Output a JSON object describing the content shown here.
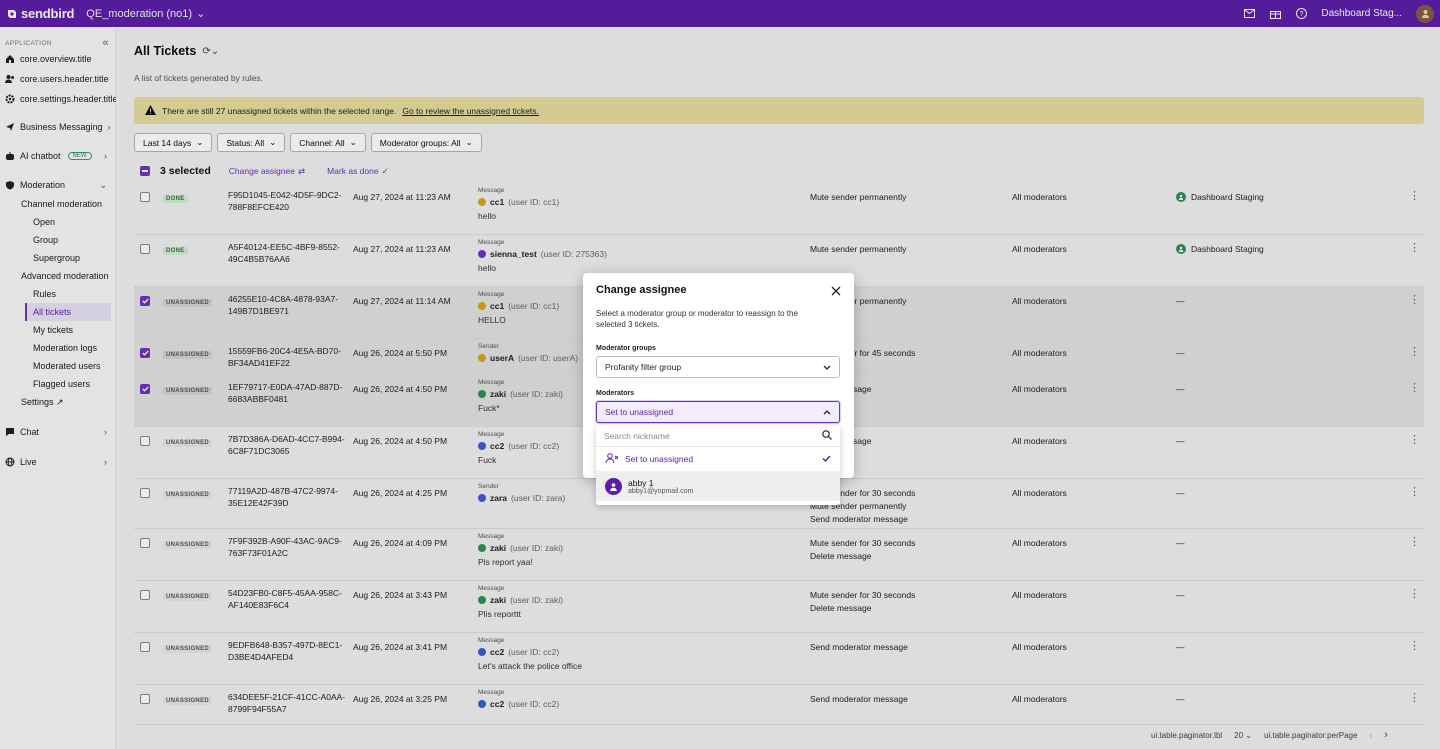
{
  "topbar": {
    "brand": "sendbird",
    "app_name": "QE_moderation (no1)",
    "org_name": "Dashboard Stag..."
  },
  "sidebar": {
    "section_label": "APPLICATION",
    "items": [
      {
        "label": "core.overview.title",
        "icon": "home-icon"
      },
      {
        "label": "core.users.header.title",
        "icon": "users-icon"
      },
      {
        "label": "core.settings.header.title",
        "icon": "gear-icon"
      },
      {
        "label": "Business Messaging",
        "icon": "send-icon"
      },
      {
        "label": "AI chatbot",
        "icon": "bot-icon",
        "badge": "NEW"
      },
      {
        "label": "Moderation",
        "icon": "shield-icon"
      },
      {
        "label": "Chat",
        "icon": "chat-icon"
      },
      {
        "label": "Live",
        "icon": "globe-icon"
      }
    ],
    "moderation": {
      "channel_moderation": "Channel moderation",
      "channel_items": [
        "Open",
        "Group",
        "Supergroup"
      ],
      "advanced_moderation": "Advanced moderation",
      "advanced_items": [
        "Rules",
        "All tickets",
        "My tickets",
        "Moderation logs",
        "Moderated users",
        "Flagged users"
      ],
      "settings": "Settings ↗"
    }
  },
  "page": {
    "title": "All Tickets",
    "description": "A list of tickets generated by rules.",
    "banner_text": "There are still 27 unassigned tickets within the selected range.",
    "banner_link": "Go to review the unassigned tickets."
  },
  "filters": [
    "Last 14 days",
    "Status: All",
    "Channel: All",
    "Moderator groups: All"
  ],
  "selection": {
    "count_label": "3 selected",
    "change_assignee": "Change assignee",
    "mark_as_done": "Mark as done"
  },
  "tickets": [
    {
      "checked": false,
      "status": "DONE",
      "id1": "F95D1045-E042-4D5F-9DC2-",
      "id2": "788F8EFCE420",
      "date": "Aug 27, 2024 at 11:23 AM",
      "type": "Message",
      "user": "cc1",
      "uid": "(user ID: cc1)",
      "text": "hello",
      "action1": "Mute sender permanently",
      "action2": "",
      "action3": "",
      "group": "All moderators",
      "assignee": "Dashboard Staging",
      "avatar_color": "#d9a520"
    },
    {
      "checked": false,
      "status": "DONE",
      "id1": "A5F40124-EE5C-4BF9-8552-",
      "id2": "49C4B5B76AA6",
      "date": "Aug 27, 2024 at 11:23 AM",
      "type": "Message",
      "user": "sienna_test",
      "uid": "(user ID: 275363)",
      "text": "hello",
      "action1": "Mute sender permanently",
      "action2": "",
      "action3": "",
      "group": "All moderators",
      "assignee": "Dashboard Staging",
      "avatar_color": "#6a34c2"
    },
    {
      "checked": true,
      "status": "UNASSIGNED",
      "id1": "46255E10-4C8A-4878-93A7-",
      "id2": "149B7D1BE971",
      "date": "Aug 27, 2024 at 11:14 AM",
      "type": "Message",
      "user": "cc1",
      "uid": "(user ID: cc1)",
      "text": "HELLO",
      "action1": "Mute sender permanently",
      "action2": "",
      "action3": "",
      "group": "All moderators",
      "assignee": "—",
      "avatar_color": "#d9a520"
    },
    {
      "checked": true,
      "status": "UNASSIGNED",
      "id1": "15559FB6-20C4-4E5A-BD70-",
      "id2": "BF34AD41EF22",
      "date": "Aug 26, 2024 at 5:50 PM",
      "type": "Sender",
      "user": "userA",
      "uid": "(user ID: userA)",
      "text": "",
      "action1": "Mute sender for 45 seconds",
      "action2": "",
      "action3": "",
      "group": "All moderators",
      "assignee": "—",
      "avatar_color": "#d9a520"
    },
    {
      "checked": true,
      "status": "UNASSIGNED",
      "id1": "1EF79717-E0DA-47AD-887D-",
      "id2": "6683ABBF0481",
      "date": "Aug 26, 2024 at 4:50 PM",
      "type": "Message",
      "user": "zaki",
      "uid": "(user ID: zaki)",
      "text": "Fuck*",
      "action1": "Delete message",
      "action2": "",
      "action3": "",
      "group": "All moderators",
      "assignee": "—",
      "avatar_color": "#2f8f5a"
    },
    {
      "checked": false,
      "status": "UNASSIGNED",
      "id1": "7B7D386A-D6AD-4CC7-B994-",
      "id2": "6C8F71DC3065",
      "date": "Aug 26, 2024 at 4:50 PM",
      "type": "Message",
      "user": "cc2",
      "uid": "(user ID: cc2)",
      "text": "Fuck",
      "action1": "Delete message",
      "action2": "",
      "action3": "",
      "group": "All moderators",
      "assignee": "—",
      "avatar_color": "#3a5fcd"
    },
    {
      "checked": false,
      "status": "UNASSIGNED",
      "id1": "77119A2D-487B-47C2-9974-",
      "id2": "35E12E42F39D",
      "date": "Aug 26, 2024 at 4:25 PM",
      "type": "Sender",
      "user": "zara",
      "uid": "(user ID: zara)",
      "text": "",
      "action1": "Mute sender for 30 seconds",
      "action2": "Mute sender permanently",
      "action3": "Send moderator message",
      "group": "All moderators",
      "assignee": "—",
      "avatar_color": "#3a5fcd"
    },
    {
      "checked": false,
      "status": "UNASSIGNED",
      "id1": "7F9F392B-A90F-43AC-9AC9-",
      "id2": "763F73F01A2C",
      "date": "Aug 26, 2024 at 4:09 PM",
      "type": "Message",
      "user": "zaki",
      "uid": "(user ID: zaki)",
      "text": "Pls report yaa!",
      "action1": "Mute sender for 30 seconds",
      "action2": "Delete message",
      "action3": "",
      "group": "All moderators",
      "assignee": "—",
      "avatar_color": "#2f8f5a"
    },
    {
      "checked": false,
      "status": "UNASSIGNED",
      "id1": "54D23FB0-C8F5-45AA-958C-",
      "id2": "AF140E83F6C4",
      "date": "Aug 26, 2024 at 3:43 PM",
      "type": "Message",
      "user": "zaki",
      "uid": "(user ID: zaki)",
      "text": "Plis reporttt",
      "action1": "Mute sender for 30 seconds",
      "action2": "Delete message",
      "action3": "",
      "group": "All moderators",
      "assignee": "—",
      "avatar_color": "#2f8f5a"
    },
    {
      "checked": false,
      "status": "UNASSIGNED",
      "id1": "9EDFB648-B357-497D-8EC1-",
      "id2": "D3BE4D4AFED4",
      "date": "Aug 26, 2024 at 3:41 PM",
      "type": "Message",
      "user": "cc2",
      "uid": "(user ID: cc2)",
      "text": "Let's attack the police office",
      "action1": "Send moderator message",
      "action2": "",
      "action3": "",
      "group": "All moderators",
      "assignee": "—",
      "avatar_color": "#3a5fcd"
    },
    {
      "checked": false,
      "status": "UNASSIGNED",
      "id1": "634DEE5F-21CF-41CC-A0AA-",
      "id2": "8799F94F55A7",
      "date": "Aug 26, 2024 at 3:25 PM",
      "type": "Message",
      "user": "cc2",
      "uid": "(user ID: cc2)",
      "text": "",
      "action1": "Send moderator message",
      "action2": "",
      "action3": "",
      "group": "All moderators",
      "assignee": "—",
      "avatar_color": "#3a5fcd"
    }
  ],
  "paginator": {
    "label": "ui.table.paginator.lbl",
    "page_size": "20",
    "per_page": "ui.table.paginator.perPage"
  },
  "modal": {
    "title": "Change assignee",
    "description": "Select a moderator group or moderator to reassign to the selected 3 tickets.",
    "groups_label": "Moderator groups",
    "groups_value": "Profanity filter group",
    "moderators_label": "Moderators",
    "moderators_value": "Set to unassigned",
    "search_placeholder": "Search nickname",
    "options": [
      {
        "label": "Set to unassigned",
        "selected": true
      },
      {
        "name": "abby 1",
        "email": "abby1@yopmail.com"
      }
    ]
  },
  "colors": {
    "brand": "#5c1ea9",
    "accent": "#6a34c2",
    "banner": "#e6dd9f"
  }
}
